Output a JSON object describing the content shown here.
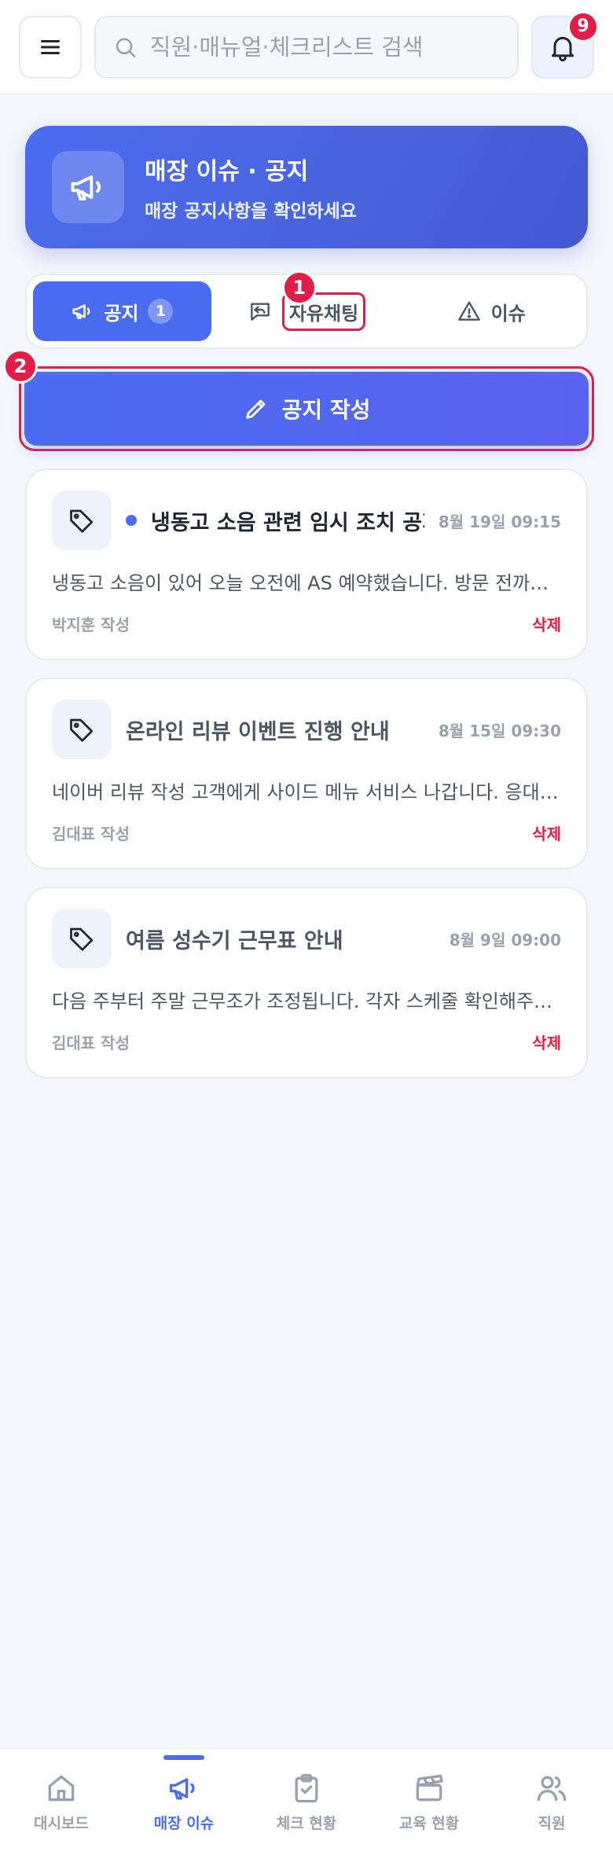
{
  "header": {
    "search_placeholder": "직원·매뉴얼·체크리스트 검색",
    "notification_count": "9"
  },
  "banner": {
    "title": "매장 이슈 · 공지",
    "subtitle": "매장 공지사항을 확인하세요"
  },
  "tabs": [
    {
      "label": "공지",
      "count": "1",
      "active": true
    },
    {
      "label": "자유채팅",
      "active": false
    },
    {
      "label": "이슈",
      "active": false
    }
  ],
  "markers": {
    "tab_free_chat": "1",
    "compose": "2"
  },
  "compose_label": "공지 작성",
  "notices": [
    {
      "title": "냉동고 소음 관련 임시 조치 공지",
      "date": "8월 19일 09:15",
      "body": "냉동고 소음이 있어 오늘 오전에 AS 예약했습니다. 방문 전까지 냉동고 문을 자주 열지 말아주세요.",
      "author": "박지훈 작성",
      "delete_label": "삭제",
      "unread": true
    },
    {
      "title": "온라인 리뷰 이벤트 진행 안내",
      "date": "8월 15일 09:30",
      "body": "네이버 리뷰 작성 고객에게 사이드 메뉴 서비스 나갑니다. 응대 시 안내 부탁드립니다.",
      "author": "김대표 작성",
      "delete_label": "삭제",
      "unread": false
    },
    {
      "title": "여름 성수기 근무표 안내",
      "date": "8월 9일 09:00",
      "body": "다음 주부터 주말 근무조가 조정됩니다. 각자 스케줄 확인해주세요.",
      "author": "김대표 작성",
      "delete_label": "삭제",
      "unread": false
    }
  ],
  "bottom_nav": [
    {
      "label": "대시보드",
      "icon": "home-icon",
      "active": false
    },
    {
      "label": "매장 이슈",
      "icon": "megaphone-icon",
      "active": true
    },
    {
      "label": "체크 현황",
      "icon": "clipboard-check-icon",
      "active": false
    },
    {
      "label": "교육 현황",
      "icon": "clapperboard-icon",
      "active": false
    },
    {
      "label": "직원",
      "icon": "users-icon",
      "active": false
    }
  ],
  "colors": {
    "accent": "#4a6cf0",
    "danger": "#e11d48",
    "muted": "#9aa1ad"
  }
}
